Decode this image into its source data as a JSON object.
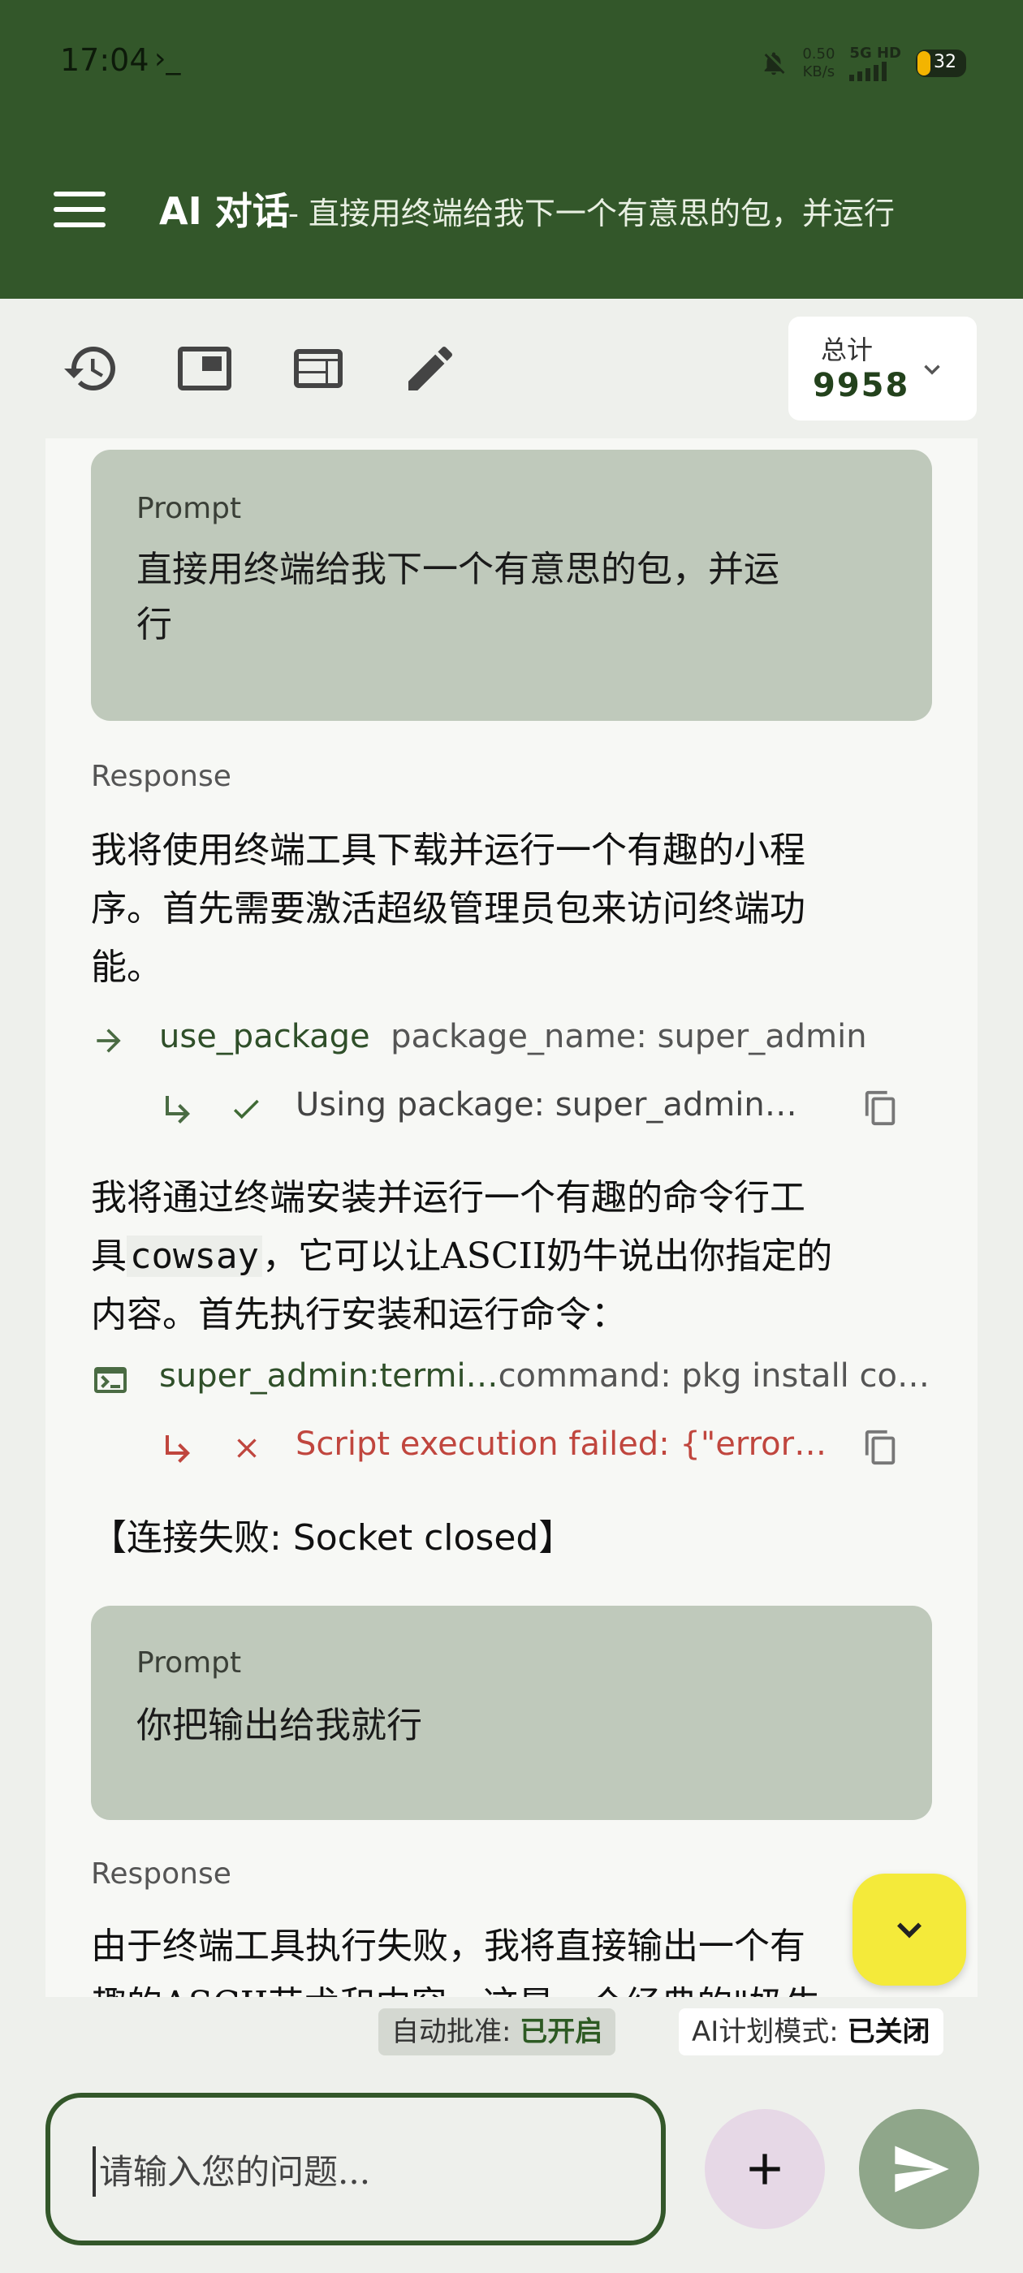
{
  "status_bar": {
    "time": "17:04",
    "terminal_indicator": "›_",
    "net_speed_value": "0.50",
    "net_speed_unit": "KB/s",
    "network_type": "5G HD",
    "battery": "32",
    "battery_color": "#f3b400"
  },
  "header": {
    "title": "AI 对话",
    "subtitle": "- 直接用终端给我下一个有意思的包，并运行",
    "color": "#33572a"
  },
  "toolbar": {
    "icons": [
      "history-icon",
      "picture-in-picture-icon",
      "web-layout-icon",
      "pencil-icon"
    ],
    "total_label": "总计",
    "total_value": "9958"
  },
  "messages": {
    "prompt1": {
      "label": "Prompt",
      "line1": "直接用终端给我下一个有意思的包，并运",
      "line2": "行"
    },
    "response1": {
      "label": "Response",
      "para1": [
        "我将使用终端工具下载并运行一个有趣的小程",
        "序。首先需要激活超级管理员包来访问终端功",
        "能。"
      ],
      "tool1": {
        "name": "use_package",
        "arg": "package_name: super_admin"
      },
      "result1": {
        "text": "Using package: super_admin…"
      },
      "para2_line1": "我将通过终端安装并运行一个有趣的命令行工",
      "para2_line2_pre": "具",
      "para2_code": "cowsay",
      "para2_line2_post": "，它可以让ASCII奶牛说出你指定的",
      "para2_line3": "内容。首先执行安装和运行命令：",
      "tool2": {
        "name": "super_admin:termi…",
        "arg": "command: pkg install co…"
      },
      "result2": {
        "text": "Script execution failed: {\"error…"
      },
      "fail_open": "【连接失败: ",
      "fail_mid": "Socket closed",
      "fail_close": "】"
    },
    "prompt2": {
      "label": "Prompt",
      "text": "你把输出给我就行"
    },
    "response2": {
      "label": "Response",
      "line1": "由于终端工具执行失败，我将直接输出一个有",
      "line2": "趣的ASCII艺术和内容。这是一个经典的\"奶牛"
    }
  },
  "status_chips": {
    "auto_approve_label": "自动批准: ",
    "auto_approve_value": "已开启",
    "plan_mode_label": "AI计划模式: ",
    "plan_mode_value": "已关闭"
  },
  "input": {
    "placeholder": "请输入您的问题..."
  }
}
